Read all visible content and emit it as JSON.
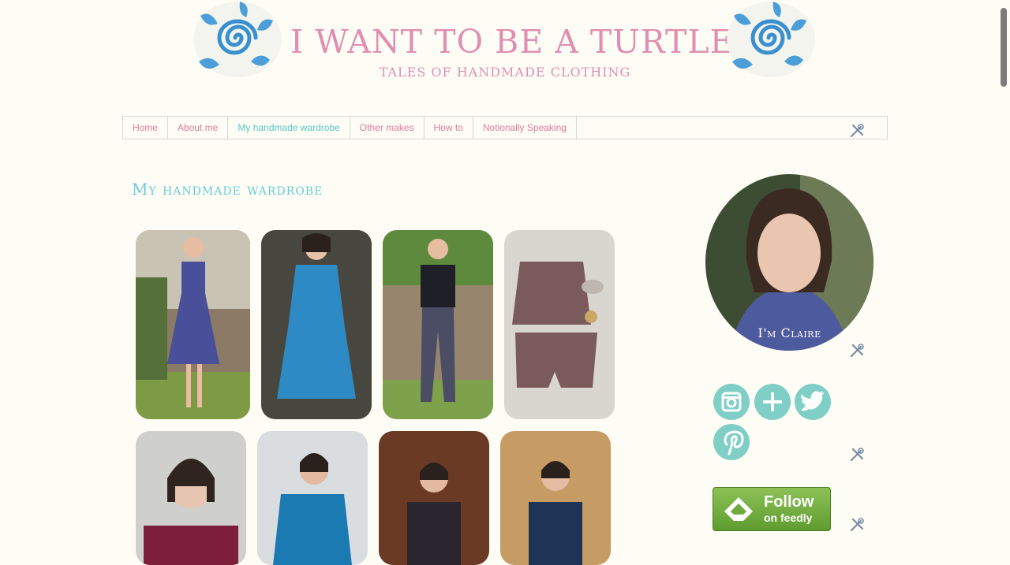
{
  "header": {
    "title": "I WANT TO BE A TURTLE",
    "subtitle": "TALES OF HANDMADE CLOTHING"
  },
  "nav": {
    "items": [
      {
        "label": "Home"
      },
      {
        "label": "About me"
      },
      {
        "label": "My handmade wardrobe"
      },
      {
        "label": "Other makes"
      },
      {
        "label": "How to"
      },
      {
        "label": "Notionally Speaking"
      }
    ],
    "active_index": 2
  },
  "main": {
    "page_title": "My handmade wardrobe"
  },
  "sidebar": {
    "avatar_caption": "I'm Claire",
    "social_icons": [
      "instagram-icon",
      "google-plus-icon",
      "twitter-icon",
      "pinterest-icon"
    ],
    "feedly": {
      "line1": "Follow",
      "line2": "on feedly"
    }
  },
  "colors": {
    "background": "#fdfdf5",
    "title_pink": "#e08fb0",
    "nav_pink": "#e07b9c",
    "accent_teal": "#5cc6c4",
    "social_teal": "#7fcfc6",
    "feedly_green": "#6faa3c"
  }
}
